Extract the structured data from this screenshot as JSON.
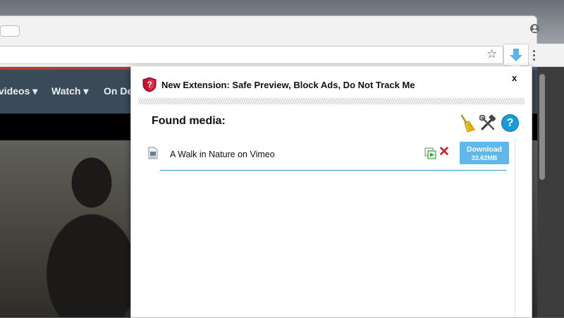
{
  "browser": {
    "toolbar": {
      "bookmark_icon": "star-icon",
      "extension_icon": "download-arrow-icon",
      "menu_icon": "kebab-icon"
    },
    "account_icon": "account-icon"
  },
  "page": {
    "nav": [
      {
        "label": "videos ▾"
      },
      {
        "label": "Watch ▾"
      },
      {
        "label": "On De"
      }
    ]
  },
  "popup": {
    "banner": {
      "text": "New Extension: Safe Preview, Block Ads, Do Not Track Me",
      "icon": "shield-question-icon"
    },
    "close_label": "x",
    "found_media_title": "Found media:",
    "tools": {
      "clear_icon": "broom-icon",
      "settings_icon": "tools-icon",
      "help_label": "?"
    },
    "media": [
      {
        "title": "A Walk in Nature on Vimeo",
        "download_label": "Download",
        "size": "33.62MB"
      }
    ],
    "colors": {
      "accent": "#1a9bd9",
      "download_button": "#5fb8ea",
      "remove": "#d21a1a",
      "shield": "#c8102e"
    }
  }
}
